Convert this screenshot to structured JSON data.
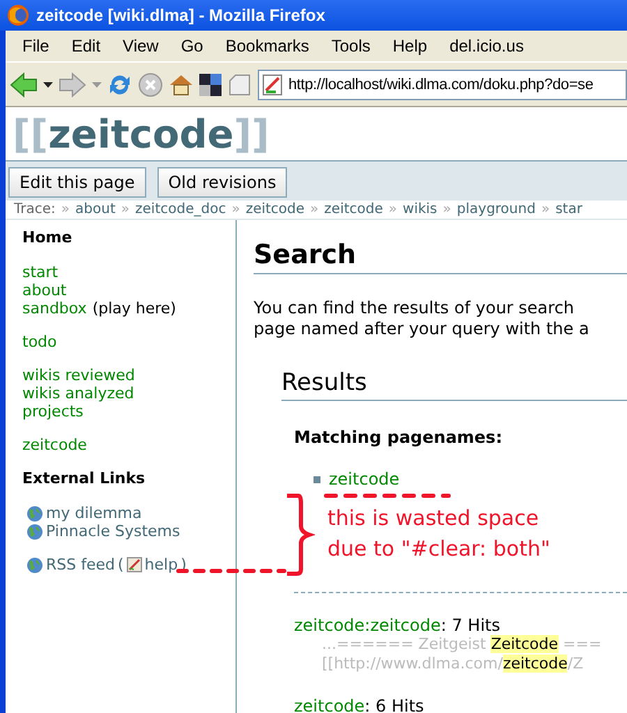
{
  "window": {
    "title": "zeitcode [wiki.dlma] - Mozilla Firefox"
  },
  "menu": [
    "File",
    "Edit",
    "View",
    "Go",
    "Bookmarks",
    "Tools",
    "Help",
    "del.icio.us"
  ],
  "address": {
    "value": "http://localhost/wiki.dlma.com/doku.php?do=se"
  },
  "site_title": {
    "open": "[[",
    "name": "zeitcode",
    "close": "]]"
  },
  "buttons": [
    "Edit this page",
    "Old revisions"
  ],
  "trace": {
    "label": "Trace:",
    "separator": "»",
    "items": [
      "about",
      "zeitcode_doc",
      "zeitcode",
      "zeitcode",
      "wikis",
      "playground",
      "star"
    ]
  },
  "sidebar": {
    "heading": "Home",
    "groups": [
      [
        {
          "link": "start"
        },
        {
          "link": "about"
        },
        {
          "link": "sandbox",
          "note": "(play here)"
        }
      ],
      [
        {
          "link": "todo"
        }
      ],
      [
        {
          "link": "wikis reviewed"
        },
        {
          "link": "wikis analyzed"
        },
        {
          "link": "projects"
        }
      ],
      [
        {
          "link": "zeitcode"
        }
      ]
    ],
    "external_heading": "External Links",
    "external_groups": [
      [
        {
          "link": "my dilemma"
        },
        {
          "link": "Pinnacle Systems"
        }
      ],
      [
        {
          "link": "RSS feed",
          "open": "(",
          "help": "help",
          "close": ")"
        }
      ]
    ]
  },
  "content": {
    "heading": "Search",
    "intro": [
      "You can find the results of your search",
      "page named after your query with the a"
    ],
    "results_heading": "Results",
    "matching_label": "Matching pagenames:",
    "pagenames": [
      "zeitcode"
    ],
    "annotation": [
      "this is wasted space",
      "due to \"#clear: both\""
    ],
    "hits": [
      {
        "page": "zeitcode:zeitcode",
        "count": ": 7 Hits",
        "snippets": [
          [
            {
              "text": "...====== Zeitgeist ",
              "highlight": false
            },
            {
              "text": "Zeitcode",
              "highlight": true
            },
            {
              "text": " ===",
              "highlight": false
            }
          ],
          [
            {
              "text": "[[http://www.dlma.com/",
              "highlight": false
            },
            {
              "text": "zeitcode",
              "highlight": true
            },
            {
              "text": "/Z",
              "highlight": false
            }
          ]
        ]
      },
      {
        "page": "zeitcode",
        "count": ": 6 Hits"
      }
    ]
  }
}
